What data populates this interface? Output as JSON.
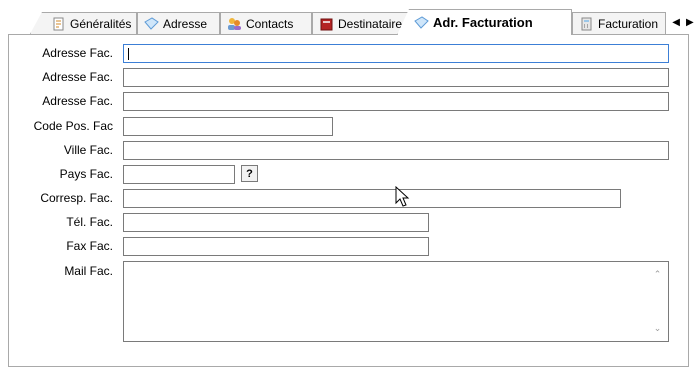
{
  "tabs": [
    {
      "label": "Généralités",
      "icon": "document-icon"
    },
    {
      "label": "Adresse",
      "icon": "envelope-icon"
    },
    {
      "label": "Contacts",
      "icon": "people-icon"
    },
    {
      "label": "Destinataire",
      "icon": "book-icon"
    },
    {
      "label": "Adr. Facturation",
      "icon": "envelope-icon",
      "active": true
    },
    {
      "label": "Facturation",
      "icon": "calculator-icon"
    }
  ],
  "fields": {
    "adresse1": {
      "label": "Adresse Fac.",
      "value": ""
    },
    "adresse2": {
      "label": "Adresse Fac.",
      "value": ""
    },
    "adresse3": {
      "label": "Adresse Fac.",
      "value": ""
    },
    "code_postal": {
      "label": "Code Pos. Fac",
      "value": ""
    },
    "ville": {
      "label": "Ville Fac.",
      "value": ""
    },
    "pays": {
      "label": "Pays Fac.",
      "value": "",
      "help": "?"
    },
    "correspondant": {
      "label": "Corresp. Fac.",
      "value": ""
    },
    "telephone": {
      "label": "Tél. Fac.",
      "value": ""
    },
    "fax": {
      "label": "Fax Fac.",
      "value": ""
    },
    "mail": {
      "label": "Mail Fac.",
      "value": ""
    }
  },
  "colors": {
    "focus_border": "#3c7fd6",
    "tab_border": "#a9a9a9"
  }
}
